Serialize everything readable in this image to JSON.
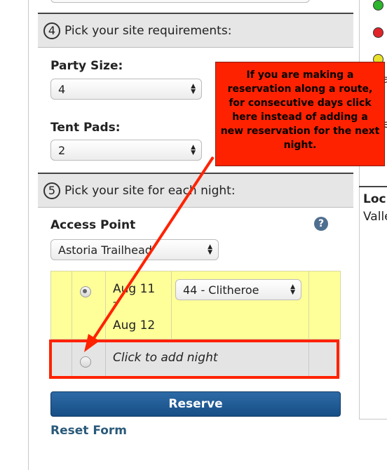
{
  "steps": {
    "step4": {
      "number": "4",
      "title": "Pick your site requirements:"
    },
    "step5": {
      "number": "5",
      "title": "Pick your site for each night:"
    }
  },
  "requirements": {
    "party_size_label": "Party Size:",
    "party_size_value": "4",
    "tent_pads_label": "Tent Pads:",
    "tent_pads_value": "2"
  },
  "access": {
    "label": "Access Point",
    "value": "Astoria Trailhead",
    "help_icon": "?"
  },
  "nights": {
    "rows": [
      {
        "date_start": "Aug 11",
        "dash": "-",
        "date_end": "Aug 12",
        "site": "44 - Clitheroe",
        "selected": true
      },
      {
        "add_text": "Click to add night",
        "selected": false
      }
    ]
  },
  "actions": {
    "reserve_label": "Reserve",
    "reset_label": "Reset Form"
  },
  "callout": {
    "text": "If you are making a reservation along a route, for consecutive days click here instead of adding a new reservation for the next night."
  },
  "right_panel": {
    "legend_colors": [
      "#2db52d",
      "#e0242a",
      "#e8e02a"
    ],
    "loc_label": "Loc",
    "loc_value": "Valle",
    "edge_glyphs": [
      "a",
      "e"
    ]
  },
  "colors": {
    "header_bg": "#e6e6e6",
    "night_row_bg": "#ffff99",
    "callout_bg": "#ff2200",
    "reserve_bg": "#1e5b94",
    "link_color": "#2a5a7a",
    "highlight_border": "#ff2200"
  }
}
